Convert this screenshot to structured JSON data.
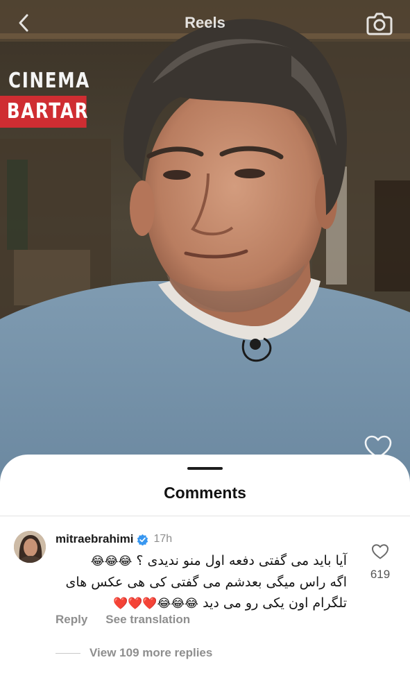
{
  "header": {
    "title": "Reels",
    "back_icon": "chevron-left-icon",
    "camera_icon": "camera-icon"
  },
  "watermark": {
    "line1": "CINEMA",
    "line2": "BARTAR",
    "accent": "#cf2d32"
  },
  "reel": {
    "like_icon": "heart-outline-icon"
  },
  "comments_sheet": {
    "title": "Comments",
    "comment": {
      "username": "mitraebrahimi",
      "verified": true,
      "verified_color": "#3897f0",
      "time": "17h",
      "text_lines": [
        "آیا باید می گفتی دفعه اول منو ندیدی ؟",
        "اگه راس میگی بعدشم می گفتی کی هی عکس های",
        "تلگرام اون یکی رو می دید"
      ],
      "line1_emoji": "😂😂😂",
      "line3_emoji": "😂😂😂❤️❤️❤️",
      "like_count": "619",
      "reply_label": "Reply",
      "translate_label": "See translation",
      "view_replies_label": "View 109 more replies"
    }
  }
}
